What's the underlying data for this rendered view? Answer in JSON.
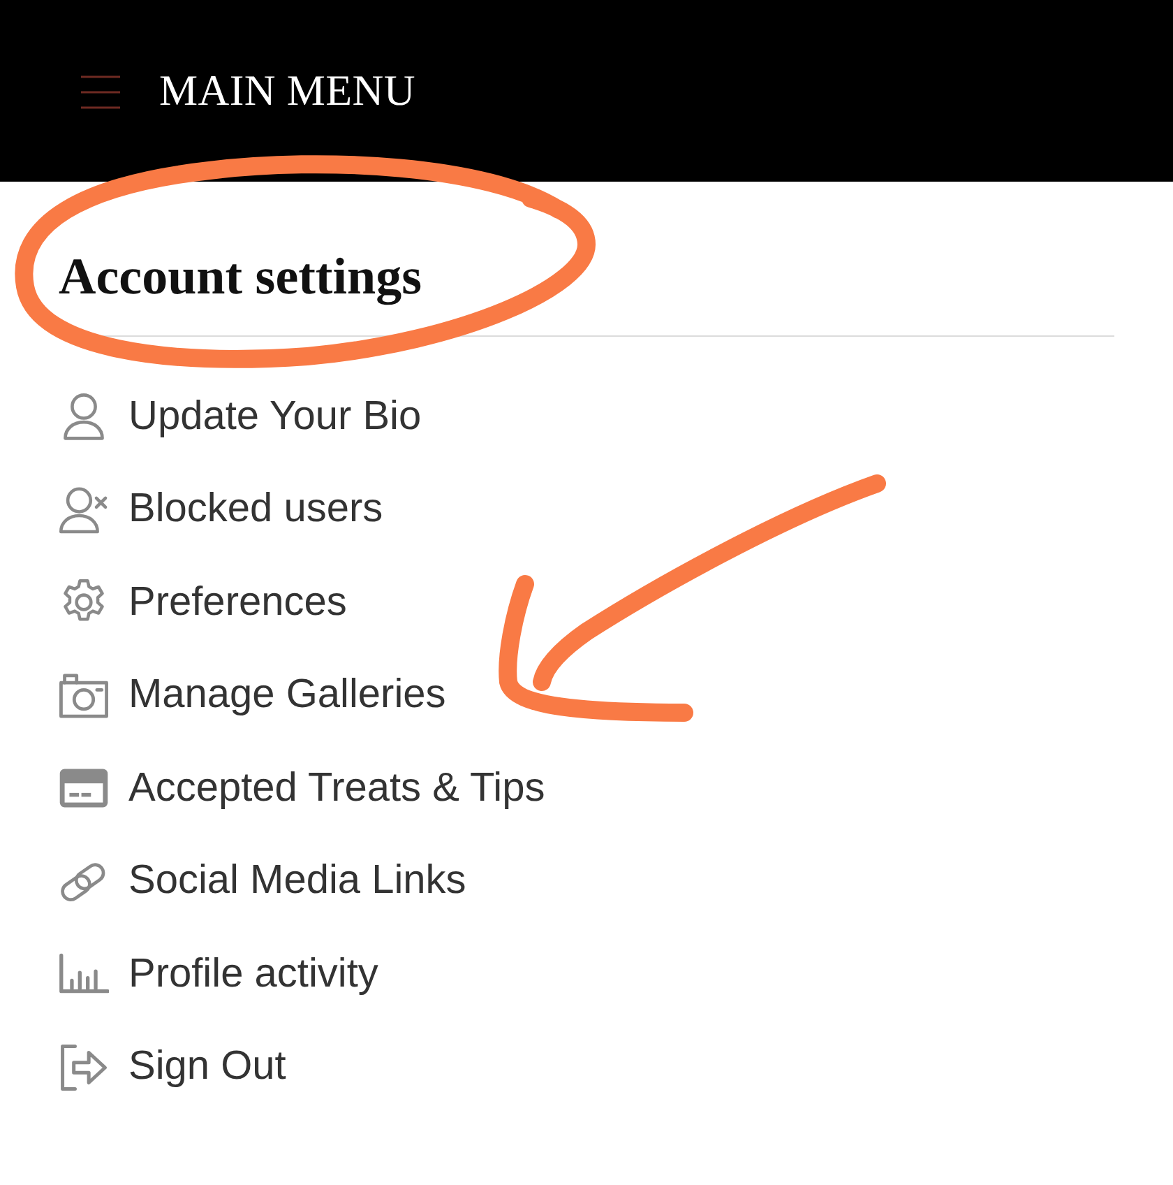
{
  "header": {
    "title": "MAIN MENU"
  },
  "section": {
    "title": "Account settings",
    "circled": true
  },
  "menu_items": [
    {
      "kind": "profile",
      "label": "Update Your Bio",
      "pointed_at": false
    },
    {
      "kind": "blocked",
      "label": "Blocked users",
      "pointed_at": false
    },
    {
      "kind": "preferences",
      "label": "Preferences",
      "pointed_at": false
    },
    {
      "kind": "galleries",
      "label": "Manage Galleries",
      "pointed_at": true
    },
    {
      "kind": "payments",
      "label": "Accepted Treats & Tips",
      "pointed_at": false
    },
    {
      "kind": "links",
      "label": "Social Media Links",
      "pointed_at": false
    },
    {
      "kind": "activity",
      "label": "Profile activity",
      "pointed_at": false
    },
    {
      "kind": "signout",
      "label": "Sign Out",
      "pointed_at": false
    }
  ]
}
